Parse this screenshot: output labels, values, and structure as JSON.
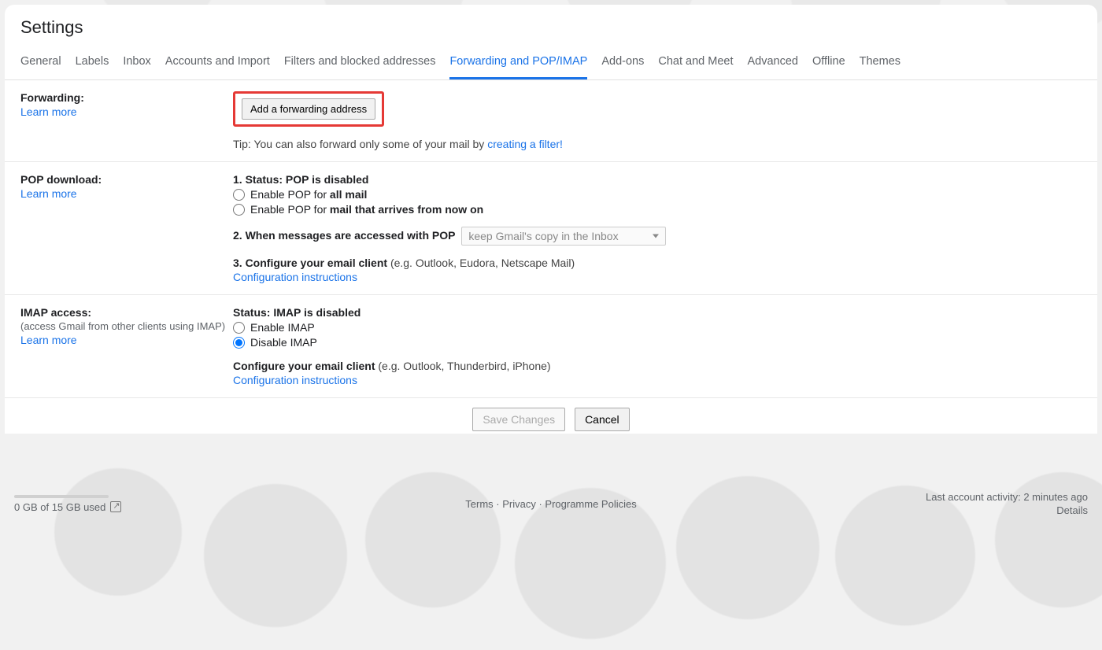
{
  "page_title": "Settings",
  "tabs": [
    {
      "label": "General",
      "active": false
    },
    {
      "label": "Labels",
      "active": false
    },
    {
      "label": "Inbox",
      "active": false
    },
    {
      "label": "Accounts and Import",
      "active": false
    },
    {
      "label": "Filters and blocked addresses",
      "active": false
    },
    {
      "label": "Forwarding and POP/IMAP",
      "active": true
    },
    {
      "label": "Add-ons",
      "active": false
    },
    {
      "label": "Chat and Meet",
      "active": false
    },
    {
      "label": "Advanced",
      "active": false
    },
    {
      "label": "Offline",
      "active": false
    },
    {
      "label": "Themes",
      "active": false
    }
  ],
  "forwarding": {
    "label": "Forwarding:",
    "learn_more": "Learn more",
    "add_button": "Add a forwarding address",
    "tip_prefix": "Tip: You can also forward only some of your mail by ",
    "tip_link": "creating a filter!"
  },
  "pop": {
    "label": "POP download:",
    "learn_more": "Learn more",
    "status_heading": "1. Status: POP is disabled",
    "opt1_prefix": "Enable POP for ",
    "opt1_bold": "all mail",
    "opt2_prefix": "Enable POP for ",
    "opt2_bold": "mail that arrives from now on",
    "when_heading": "2. When messages are accessed with POP",
    "when_select": "keep Gmail's copy in the Inbox",
    "configure_heading": "3. Configure your email client ",
    "configure_note": "(e.g. Outlook, Eudora, Netscape Mail)",
    "configure_link": "Configuration instructions"
  },
  "imap": {
    "label": "IMAP access:",
    "sub": "(access Gmail from other clients using IMAP)",
    "learn_more": "Learn more",
    "status_heading": "Status: IMAP is disabled",
    "opt1": "Enable IMAP",
    "opt2": "Disable IMAP",
    "configure_heading": "Configure your email client ",
    "configure_note": "(e.g. Outlook, Thunderbird, iPhone)",
    "configure_link": "Configuration instructions"
  },
  "buttons": {
    "save": "Save Changes",
    "cancel": "Cancel"
  },
  "footer": {
    "storage": "0 GB of 15 GB used",
    "terms": "Terms",
    "privacy": "Privacy",
    "policies": "Programme Policies",
    "activity": "Last account activity: 2 minutes ago",
    "details": "Details",
    "sep": " · "
  }
}
